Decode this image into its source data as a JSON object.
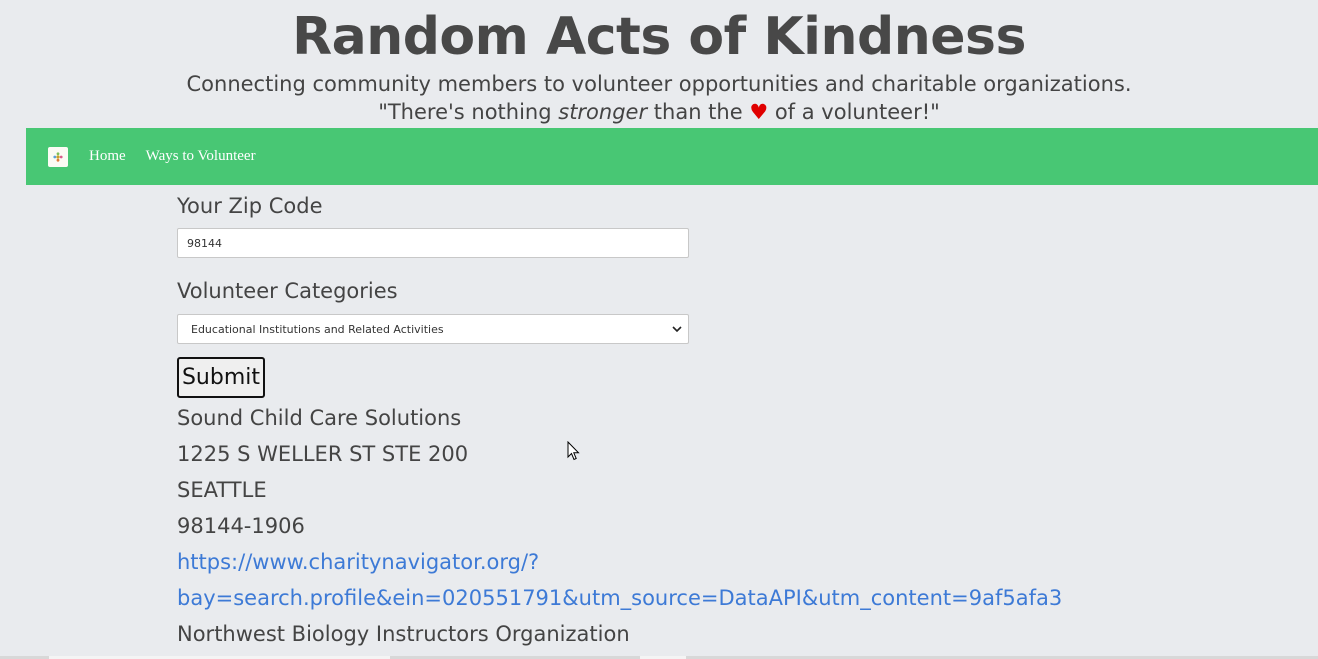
{
  "header": {
    "title": "Random Acts of Kindness",
    "tagline": "Connecting community members to volunteer opportunities and charitable organizations.",
    "quote_before": "\"There's nothing ",
    "quote_emphasis": "stronger",
    "quote_middle": " than the ",
    "quote_heart": "♥",
    "quote_after": " of a volunteer!\""
  },
  "navbar": {
    "brand_icon": "logo-icon",
    "home_label": "Home",
    "ways_label": "Ways to Volunteer"
  },
  "form": {
    "zip_label": "Your Zip Code",
    "zip_value": "98144",
    "category_label": "Volunteer Categories",
    "category_selected": "Educational Institutions and Related Activities",
    "submit_label": "Submit"
  },
  "results": [
    {
      "name": "Sound Child Care Solutions",
      "street": "1225 S WELLER ST STE 200",
      "city": "SEATTLE",
      "zip": "98144-1906",
      "url_line1": "https://www.charitynavigator.org/?",
      "url_line2": "bay=search.profile&ein=020551791&utm_source=DataAPI&utm_content=9af5afa3"
    },
    {
      "name": "Northwest Biology Instructors Organization"
    }
  ],
  "colors": {
    "navbar": "#48c774",
    "link": "#3d7ad6",
    "heart": "#e00000",
    "background": "#e9ebee"
  }
}
